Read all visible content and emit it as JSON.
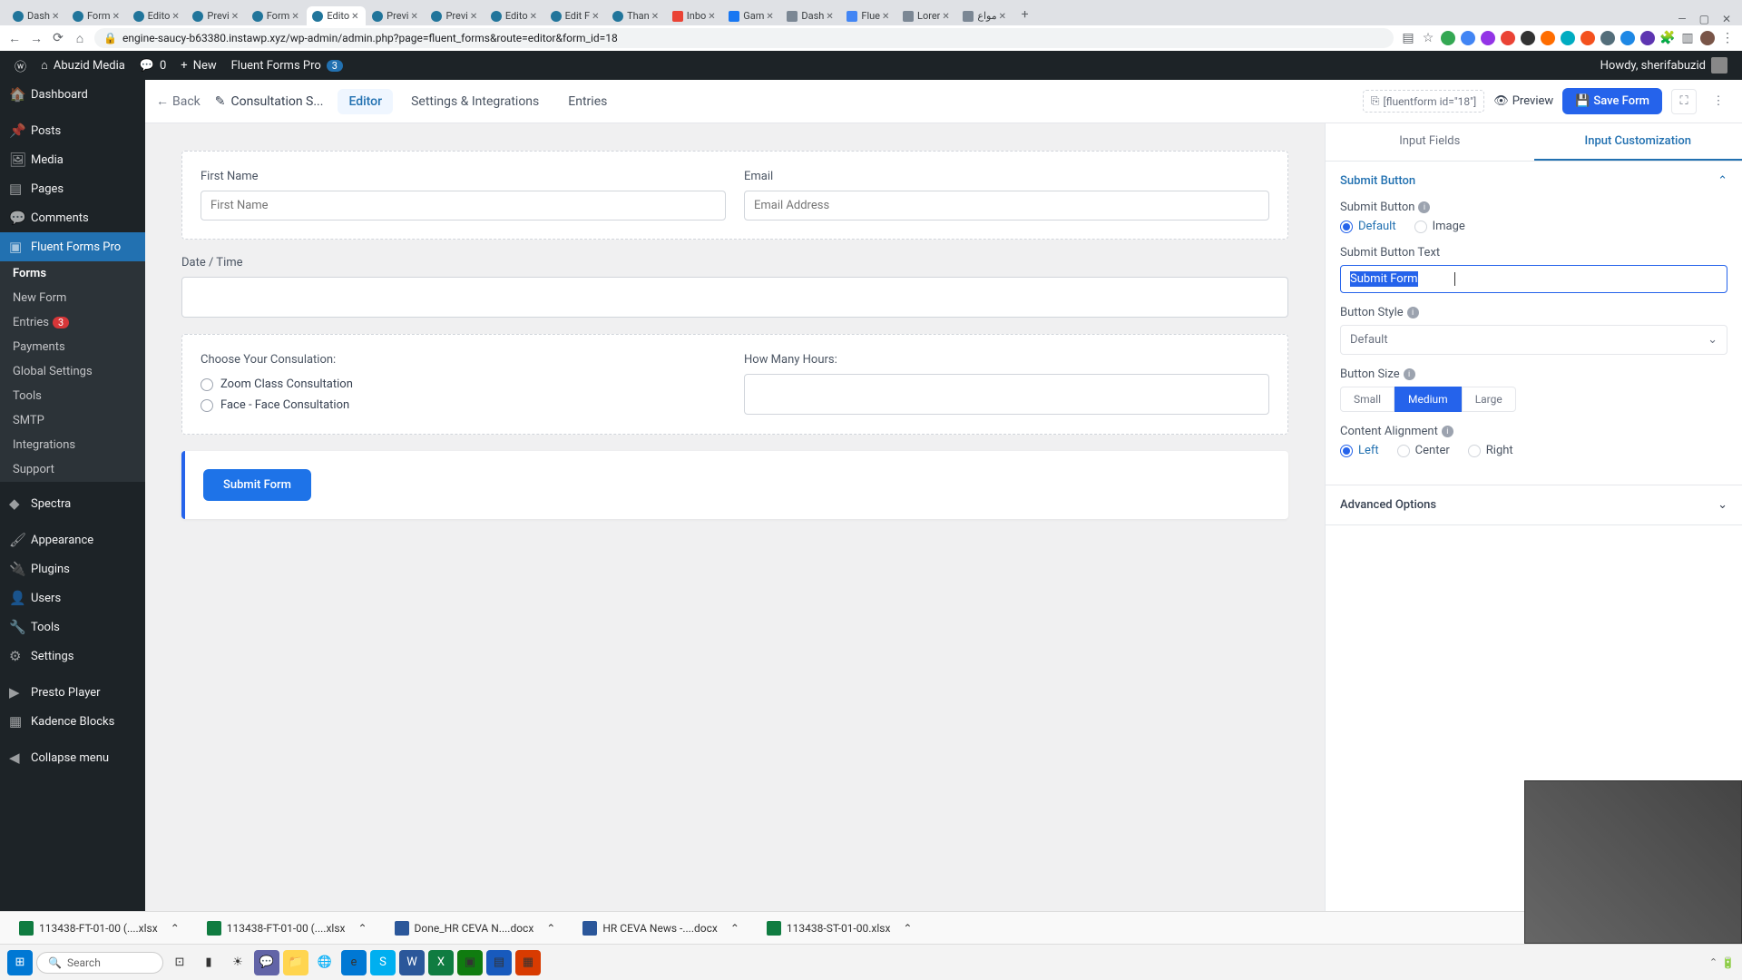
{
  "browser": {
    "tabs": [
      {
        "title": "Dash",
        "active": false
      },
      {
        "title": "Form",
        "active": false
      },
      {
        "title": "Edito",
        "active": false
      },
      {
        "title": "Previ",
        "active": false
      },
      {
        "title": "Form",
        "active": false
      },
      {
        "title": "Edito",
        "active": true
      },
      {
        "title": "Previ",
        "active": false
      },
      {
        "title": "Previ",
        "active": false
      },
      {
        "title": "Edito",
        "active": false
      },
      {
        "title": "Edit F",
        "active": false
      },
      {
        "title": "Than",
        "active": false
      },
      {
        "title": "Inbo",
        "active": false
      },
      {
        "title": "Gam",
        "active": false
      },
      {
        "title": "Dash",
        "active": false
      },
      {
        "title": "Flue",
        "active": false
      },
      {
        "title": "Lorer",
        "active": false
      },
      {
        "title": "مواع",
        "active": false
      }
    ],
    "url": "engine-saucy-b63380.instawp.xyz/wp-admin/admin.php?page=fluent_forms&route=editor&form_id=18"
  },
  "adminbar": {
    "site": "Abuzid Media",
    "comments": "0",
    "new": "New",
    "fluent": "Fluent Forms Pro",
    "fluent_badge": "3",
    "howdy": "Howdy, sherifabuzid"
  },
  "sidebar": {
    "items": [
      {
        "label": "Dashboard",
        "icon": "⌂"
      },
      {
        "label": "Posts",
        "icon": "📌"
      },
      {
        "label": "Media",
        "icon": "🖼"
      },
      {
        "label": "Pages",
        "icon": "▤"
      },
      {
        "label": "Comments",
        "icon": "💬"
      },
      {
        "label": "Fluent Forms Pro",
        "icon": "▣",
        "active": true
      }
    ],
    "submenu": [
      {
        "label": "Forms",
        "active": true
      },
      {
        "label": "New Form"
      },
      {
        "label": "Entries",
        "badge": "3"
      },
      {
        "label": "Payments"
      },
      {
        "label": "Global Settings"
      },
      {
        "label": "Tools"
      },
      {
        "label": "SMTP"
      },
      {
        "label": "Integrations"
      },
      {
        "label": "Support"
      }
    ],
    "items2": [
      {
        "label": "Spectra",
        "icon": "◆"
      },
      {
        "label": "Appearance",
        "icon": "🖌"
      },
      {
        "label": "Plugins",
        "icon": "🔌"
      },
      {
        "label": "Users",
        "icon": "👤"
      },
      {
        "label": "Tools",
        "icon": "🔧"
      },
      {
        "label": "Settings",
        "icon": "⚙"
      },
      {
        "label": "Presto Player",
        "icon": "▶"
      },
      {
        "label": "Kadence Blocks",
        "icon": "▦"
      },
      {
        "label": "Collapse menu",
        "icon": "◀"
      }
    ]
  },
  "topbar": {
    "back": "Back",
    "form_title": "Consultation S...",
    "tabs": [
      {
        "label": "Editor",
        "active": true
      },
      {
        "label": "Settings & Integrations"
      },
      {
        "label": "Entries"
      }
    ],
    "shortcode": "[fluentform id=\"18\"]",
    "preview": "Preview",
    "save": "Save Form"
  },
  "form": {
    "first_name_label": "First Name",
    "first_name_ph": "First Name",
    "email_label": "Email",
    "email_ph": "Email Address",
    "date_label": "Date / Time",
    "choose_label": "Choose Your Consulation:",
    "opt1": "Zoom Class Consultation",
    "opt2": "Face - Face Consultation",
    "hours_label": "How Many Hours:",
    "submit": "Submit Form"
  },
  "panel": {
    "tab1": "Input Fields",
    "tab2": "Input Customization",
    "section1": "Submit Button",
    "submit_button_label": "Submit Button",
    "opt_default": "Default",
    "opt_image": "Image",
    "text_label": "Submit Button Text",
    "text_value": "Submit Form",
    "style_label": "Button Style",
    "style_value": "Default",
    "size_label": "Button Size",
    "size_small": "Small",
    "size_medium": "Medium",
    "size_large": "Large",
    "align_label": "Content Alignment",
    "align_left": "Left",
    "align_center": "Center",
    "align_right": "Right",
    "section2": "Advanced Options"
  },
  "downloads": [
    "113438-FT-01-00 (....xlsx",
    "113438-FT-01-00 (....xlsx",
    "Done_HR CEVA N....docx",
    "HR CEVA News -....docx",
    "113438-ST-01-00.xlsx"
  ],
  "taskbar": {
    "search_ph": "Search"
  }
}
